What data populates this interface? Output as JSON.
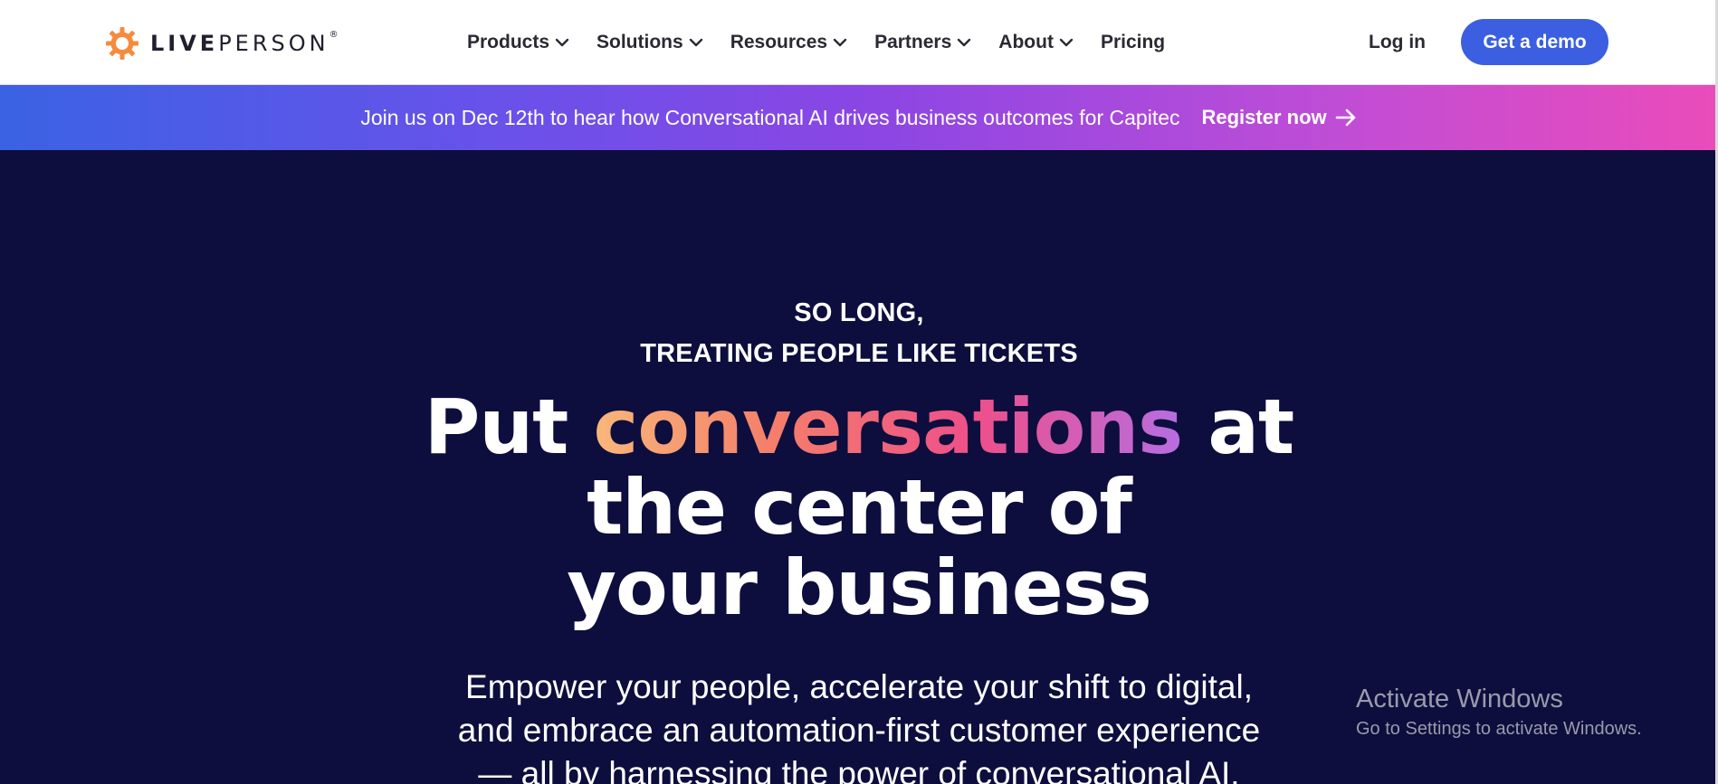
{
  "header": {
    "logo": {
      "brand_bold": "LIVE",
      "brand_light": "PERSON",
      "registered": "®",
      "mark_icon": "gear-sun-icon",
      "accent": "#f58b3c"
    },
    "nav": [
      {
        "label": "Products",
        "icon": "chevron-down-icon"
      },
      {
        "label": "Solutions",
        "icon": "chevron-down-icon"
      },
      {
        "label": "Resources",
        "icon": "chevron-down-icon"
      },
      {
        "label": "Partners",
        "icon": "chevron-down-icon"
      },
      {
        "label": "About",
        "icon": "chevron-down-icon"
      },
      {
        "label": "Pricing"
      }
    ],
    "login_label": "Log in",
    "demo_label": "Get a demo",
    "demo_color": "#3b5fe0"
  },
  "banner": {
    "text": "Join us on Dec 12th to hear how Conversational AI drives business outcomes for Capitec",
    "link_label": "Register now",
    "link_icon": "arrow-right-icon"
  },
  "hero": {
    "eyebrow_line1": "SO LONG,",
    "eyebrow_line2": "TREATING PEOPLE LIKE TICKETS",
    "headline_before": "Put ",
    "headline_highlight": "conversations",
    "headline_after": " at",
    "headline_line2": "the center of",
    "headline_line3": "your business",
    "sub_line1": "Empower your people, accelerate your shift to digital,",
    "sub_line2": "and embrace an automation-first customer experience",
    "sub_line3": "— all by harnessing the power of conversational AI.",
    "background": "#0d0e3d"
  },
  "watermark": {
    "title": "Activate Windows",
    "subtitle": "Go to Settings to activate Windows."
  }
}
